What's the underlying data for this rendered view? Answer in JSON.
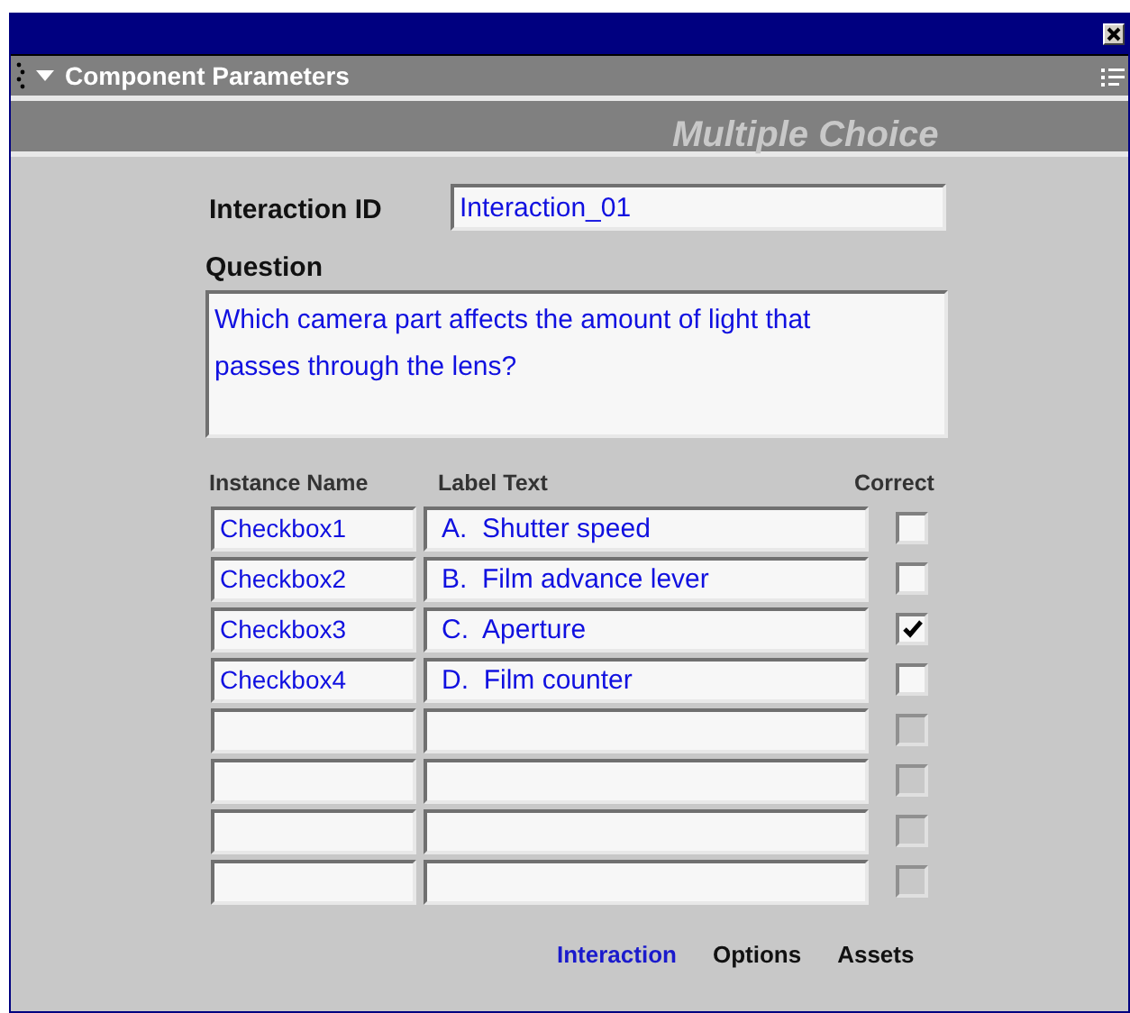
{
  "panel": {
    "title": "Component Parameters",
    "expanded": true
  },
  "banner": "Multiple Choice",
  "interaction_id": {
    "label": "Interaction ID",
    "value": "Interaction_01"
  },
  "question": {
    "label": "Question",
    "value": "Which camera part affects the amount of light that passes through the lens?"
  },
  "table": {
    "columns": [
      "Instance Name",
      "Label Text",
      "Correct"
    ],
    "rows": [
      {
        "instance_name": "Checkbox1",
        "label_text": "A.  Shutter speed",
        "checked": false,
        "disabled": false
      },
      {
        "instance_name": "Checkbox2",
        "label_text": "B.  Film advance lever",
        "checked": false,
        "disabled": false
      },
      {
        "instance_name": "Checkbox3",
        "label_text": "C.  Aperture",
        "checked": true,
        "disabled": false
      },
      {
        "instance_name": "Checkbox4",
        "label_text": "D.  Film counter",
        "checked": false,
        "disabled": false
      },
      {
        "checked": false,
        "disabled": true
      },
      {
        "checked": false,
        "disabled": true
      },
      {
        "checked": false,
        "disabled": true
      },
      {
        "checked": false,
        "disabled": true
      }
    ]
  },
  "tabs": [
    {
      "label": "Interaction",
      "selected": true
    },
    {
      "label": "Options",
      "selected": false
    },
    {
      "label": "Assets",
      "selected": false
    }
  ]
}
